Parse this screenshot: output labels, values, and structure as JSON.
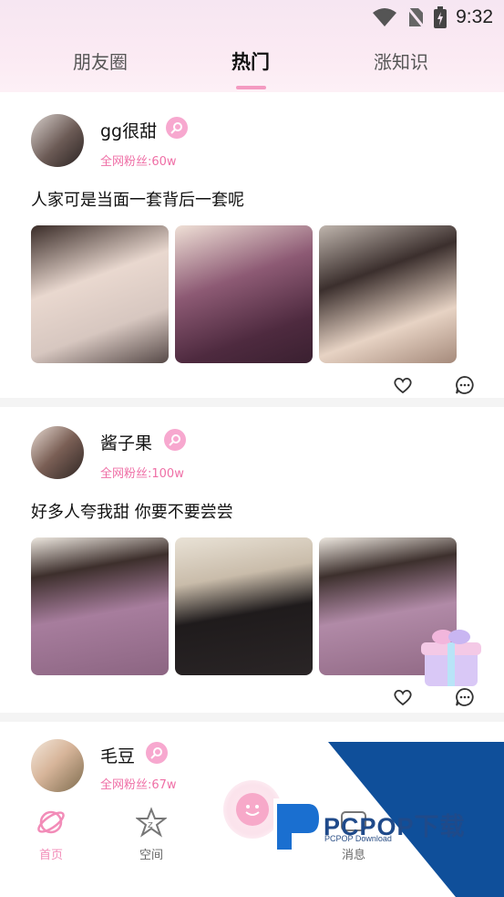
{
  "status_bar": {
    "time": "9:32",
    "icons": [
      "wifi-icon",
      "no-sim-icon",
      "battery-charging-icon"
    ]
  },
  "top_tabs": [
    {
      "label": "朋友圈",
      "active": false
    },
    {
      "label": "热门",
      "active": true
    },
    {
      "label": "涨知识",
      "active": false
    }
  ],
  "posts": [
    {
      "username": "gg很甜",
      "fans": "全网粉丝:60w",
      "text": "人家可是当面一套背后一套呢",
      "photos": [
        "selfie-duo-photo",
        "mirror-selfie-photo",
        "heart-hands-duo-photo"
      ],
      "actions": [
        "heart-icon",
        "comment-icon"
      ]
    },
    {
      "username": "酱子果",
      "fans": "全网粉丝:100w",
      "text": "好多人夸我甜 你要不要尝尝",
      "photos": [
        "purple-top-photo",
        "black-dress-photo",
        "purple-top-closeup-photo"
      ],
      "actions": [
        "heart-icon",
        "comment-icon"
      ]
    },
    {
      "username": "毛豆",
      "fans": "全网粉丝:67w"
    }
  ],
  "bottom_nav": [
    {
      "label": "首页",
      "icon": "planet-icon",
      "active": true
    },
    {
      "label": "空间",
      "icon": "star-icon",
      "active": false
    },
    {
      "label": "消息",
      "icon": "message-icon",
      "active": false
    }
  ],
  "watermark": {
    "brand": "PCPOP下载",
    "sub": "PCPOP Download"
  },
  "colors": {
    "accent_pink": "#f28cb8",
    "fans_pink": "#ef6fa6",
    "badge_pink": "#f7a8cf"
  }
}
